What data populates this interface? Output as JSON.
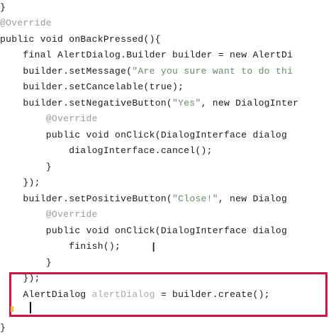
{
  "code": {
    "line1": "}",
    "line2": "@Override",
    "line3": "public void onBackPressed(){",
    "line4": "    final AlertDialog.Builder builder = new AlertDi",
    "line5a": "    builder.setMessage(",
    "line5b": "\"Are you sure want to do thi",
    "line6": "    builder.setCancelable(true);",
    "line7a": "    builder.setNegativeButton(",
    "line7b": "\"Yes\"",
    "line7c": ", new DialogInter",
    "line8": "        @Override",
    "line9": "        public void onClick(DialogInterface dialog",
    "line10": "            dialogInterface.cancel();",
    "line11": "        }",
    "line12": "    });",
    "line13a": "    builder.setPositiveButton(",
    "line13b": "\"Close!\"",
    "line13c": ", new Dialog",
    "line14": "        @Override",
    "line15": "        public void onClick(DialogInterface dialog",
    "line16": "            finish();",
    "line17": "        }",
    "line18": "    });",
    "line19a": "    AlertDialog ",
    "line19b": "alertDialog",
    "line19c": " = builder.create();",
    "line20": "    ",
    "line21": "}"
  },
  "ibeam_glyph": "I",
  "colors": {
    "highlight_border": "#c8184a",
    "annotation": "#9a9a9a",
    "caret": "#000000"
  }
}
